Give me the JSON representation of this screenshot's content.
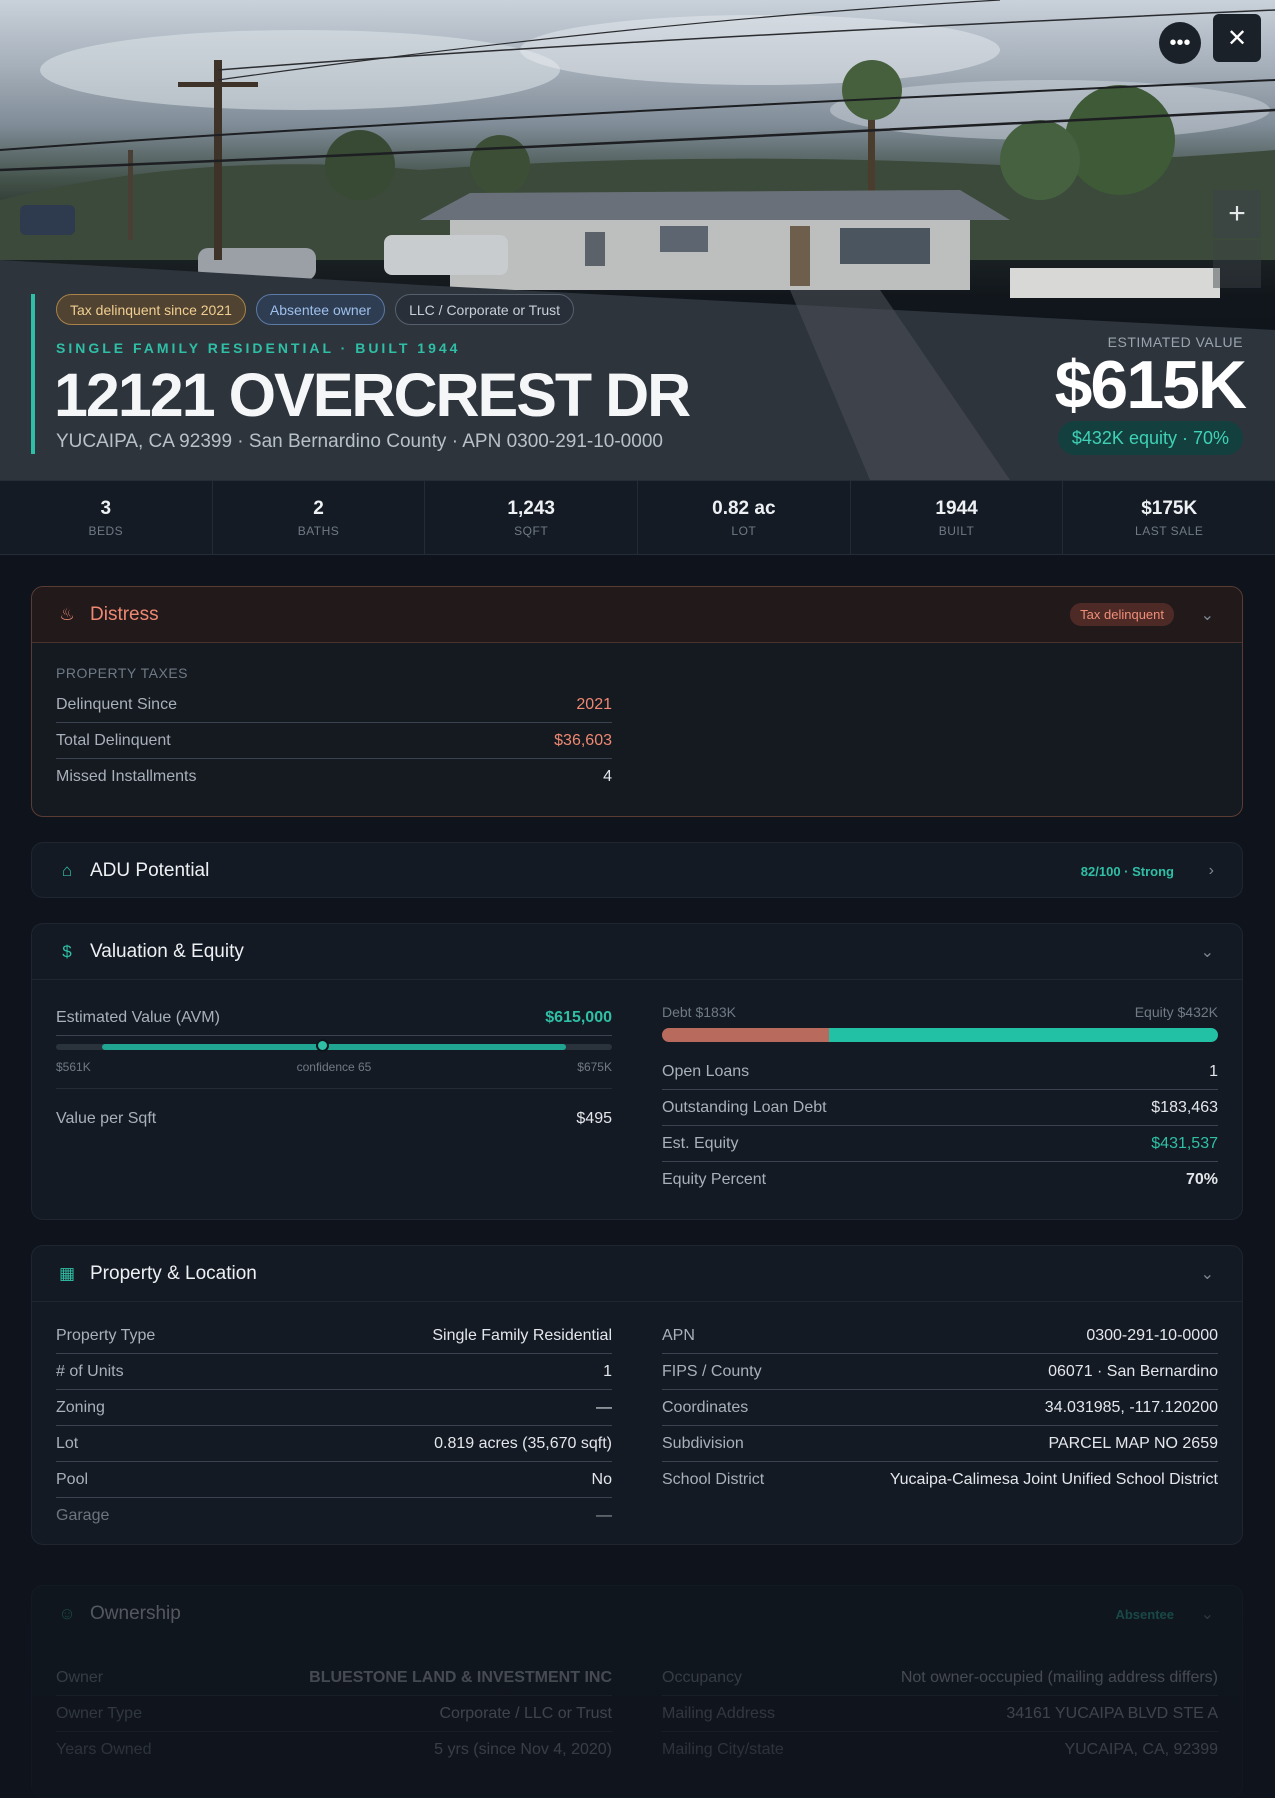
{
  "hero": {
    "chips": [
      {
        "label": "Tax delinquent since 2021"
      },
      {
        "label": "Absentee owner"
      },
      {
        "label": "LLC / Corporate or Trust"
      }
    ],
    "eyebrow": "SINGLE FAMILY RESIDENTIAL · BUILT 1944",
    "street": "12121 OVERCREST DR",
    "subaddress": "YUCAIPA, CA 92399 · San Bernardino County · APN 0300-291-10-0000",
    "estimated_label": "ESTIMATED VALUE",
    "estimated_value": "$615K",
    "equity_pill": "$432K equity · 70%",
    "more_icon": "more-horizontal-icon",
    "close_icon": "close-icon",
    "zoom_in": "+"
  },
  "stats": [
    {
      "value": "3",
      "label": "BEDS"
    },
    {
      "value": "2",
      "label": "BATHS"
    },
    {
      "value": "1,243",
      "label": "SQFT"
    },
    {
      "value": "0.82 ac",
      "label": "LOT"
    },
    {
      "value": "1944",
      "label": "BUILT"
    },
    {
      "value": "$175K",
      "label": "LAST SALE"
    }
  ],
  "distress": {
    "title": "Distress",
    "badge": "Tax delinquent",
    "section_label": "PROPERTY TAXES",
    "rows": [
      {
        "k": "Delinquent Since",
        "v": "2021"
      },
      {
        "k": "Total Delinquent",
        "v": "$36,603"
      },
      {
        "k": "Missed Installments",
        "v": "4"
      }
    ]
  },
  "adu": {
    "title": "ADU Potential",
    "badge": "82/100 · Strong"
  },
  "valuation": {
    "title": "Valuation & Equity",
    "avm_label": "Estimated Value (AVM)",
    "avm_value": "$615,000",
    "range_low": "$561K",
    "confidence": "confidence 65",
    "range_high": "$675K",
    "range_low_num": 561,
    "range_high_num": 675,
    "avm_num": 615,
    "per_sqft_label": "Value per Sqft",
    "per_sqft_value": "$495",
    "debt_label": "Debt $183K",
    "equity_label": "Equity $432K",
    "debt_fraction": 0.3,
    "rows": [
      {
        "k": "Open Loans",
        "v": "1"
      },
      {
        "k": "Outstanding Loan Debt",
        "v": "$183,463"
      },
      {
        "k": "Est. Equity",
        "v": "$431,537"
      },
      {
        "k": "Equity Percent",
        "v": "70%"
      }
    ]
  },
  "property": {
    "title": "Property & Location",
    "left": [
      {
        "k": "Property Type",
        "v": "Single Family Residential"
      },
      {
        "k": "# of Units",
        "v": "1"
      },
      {
        "k": "Zoning",
        "v": "—"
      },
      {
        "k": "Lot",
        "v": "0.819 acres (35,670 sqft)"
      },
      {
        "k": "Pool",
        "v": "No"
      },
      {
        "k": "Garage",
        "v": "—"
      }
    ],
    "right": [
      {
        "k": "APN",
        "v": "0300-291-10-0000"
      },
      {
        "k": "FIPS / County",
        "v": "06071 · San Bernardino"
      },
      {
        "k": "Coordinates",
        "v": "34.031985, -117.120200"
      },
      {
        "k": "Subdivision",
        "v": "PARCEL MAP NO 2659"
      },
      {
        "k": "School District",
        "v": "Yucaipa-Calimesa Joint Unified School District"
      }
    ]
  },
  "ownership": {
    "title": "Ownership",
    "badge": "Absentee",
    "left": [
      {
        "k": "Owner",
        "v": "BLUESTONE LAND & INVESTMENT INC"
      },
      {
        "k": "Owner Type",
        "v": "Corporate / LLC or Trust"
      },
      {
        "k": "Years Owned",
        "v": "5 yrs (since Nov 4, 2020)"
      }
    ],
    "right": [
      {
        "k": "Occupancy",
        "v": "Not owner-occupied (mailing address differs)"
      },
      {
        "k": "Mailing Address",
        "v": "34161 YUCAIPA BLVD STE A"
      },
      {
        "k": "Mailing City/state",
        "v": "YUCAIPA, CA, 92399"
      }
    ]
  },
  "colors": {
    "accent": "#2fbfa6",
    "distress": "#ee8872",
    "debt": "#b86b5c",
    "equity": "#22c0a5"
  }
}
